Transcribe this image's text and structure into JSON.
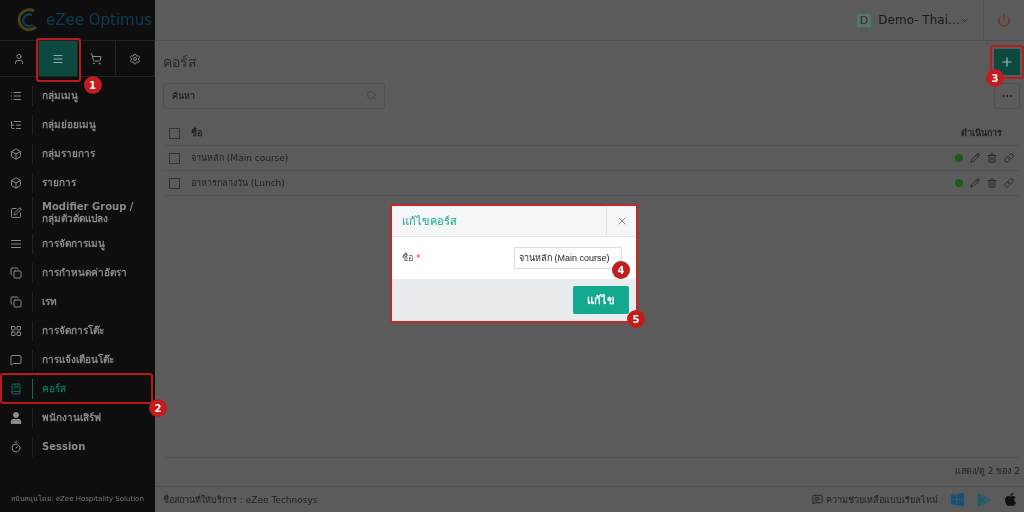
{
  "sidebar": {
    "logo": "eZee Optimus",
    "tabs": [
      {
        "kind": "user",
        "selected": false
      },
      {
        "kind": "menu",
        "selected": true,
        "callout": "1"
      },
      {
        "kind": "cart",
        "selected": false
      },
      {
        "kind": "settings",
        "selected": false
      }
    ],
    "items": [
      {
        "label": "กลุ่มเมนู",
        "selected": false
      },
      {
        "label": "กลุ่มย่อยเมนู",
        "selected": false
      },
      {
        "label": "กลุ่มรายการ",
        "selected": false
      },
      {
        "label": "รายการ",
        "selected": false
      },
      {
        "label": "Modifier Group / กลุ่มตัวดัดแปลง",
        "selected": false
      },
      {
        "label": "การจัดการเมนู",
        "selected": false
      },
      {
        "label": "การกำหนดค่าอัตรา",
        "selected": false
      },
      {
        "label": "เรท",
        "selected": false
      },
      {
        "label": "การจัดการโต๊ะ",
        "selected": false
      },
      {
        "label": "การแจ้งเตือนโต๊ะ",
        "selected": false
      },
      {
        "label": "คอร์ส",
        "selected": true,
        "callout": "2"
      },
      {
        "label": "พนักงานเสิร์ฟ",
        "selected": false
      },
      {
        "label": "Session",
        "selected": false
      }
    ],
    "footer": "สนับสนุนโดย: eZee Hospitality Solution"
  },
  "header": {
    "badge": "D",
    "property": "Demo- Thai…"
  },
  "page": {
    "title": "คอร์ส",
    "add_callout": "3",
    "search": {
      "placeholder": "ค้นหา"
    },
    "columns": [
      "ชื่อ",
      "ดำเนินการ"
    ],
    "all_checked": false,
    "rows": [
      {
        "name": "จานหลัก (Main course)",
        "active": true,
        "checked": false
      },
      {
        "name": "อาหารกลางวัน (Lunch)",
        "active": true,
        "checked": false
      }
    ],
    "pagination": "แสดง/ดู 2 ของ 2"
  },
  "footer": {
    "left": "ชื่อสถานที่ให้บริการ : eZee Technosys",
    "help": "ความช่วยเหลือแบบเรียลไทม์"
  },
  "modal": {
    "title": "แก้ไขคอร์ส",
    "field": {
      "label": "ชื่อ",
      "required_mark": "*",
      "value": "จานหลัก (Main course)",
      "callout": "4"
    },
    "button": {
      "label": "แก้ไข",
      "callout": "5"
    }
  }
}
